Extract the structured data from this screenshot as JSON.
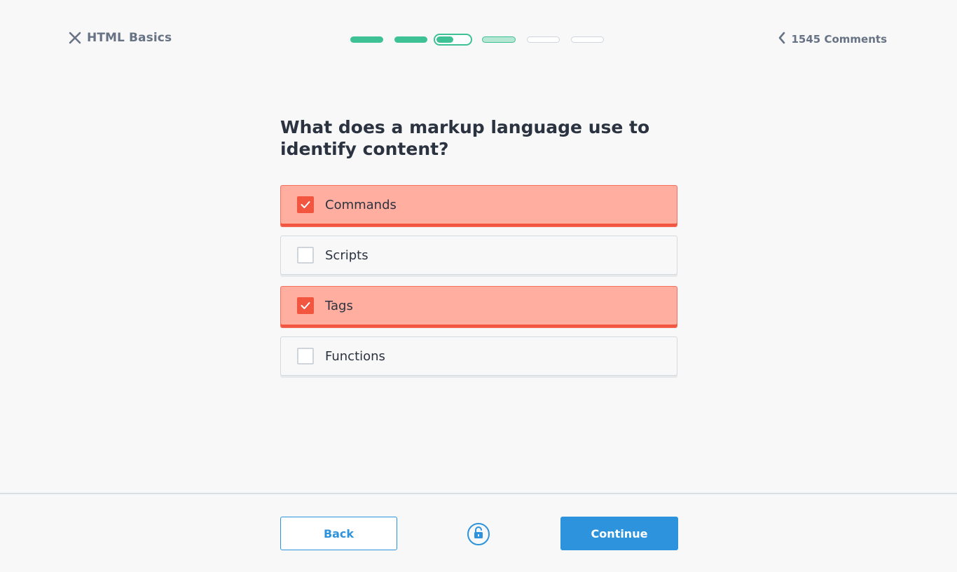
{
  "header": {
    "course_title": "HTML Basics",
    "comments_label": "1545 Comments"
  },
  "progress": {
    "total_steps": 6,
    "completed_steps": 2,
    "current_step": 3,
    "current_step_fill": 0.5
  },
  "question": {
    "text": "What does a markup language use to identify content?"
  },
  "options": [
    {
      "label": "Commands",
      "checked": true
    },
    {
      "label": "Scripts",
      "checked": false
    },
    {
      "label": "Tags",
      "checked": true
    },
    {
      "label": "Functions",
      "checked": false
    }
  ],
  "footer": {
    "back_label": "Back",
    "continue_label": "Continue",
    "unlock_icon": "unlock-icon"
  },
  "colors": {
    "accent": "#2d93dc",
    "progress": "#3ec195",
    "selected_bg": "#ffaea0",
    "selected_border": "#f25640"
  }
}
